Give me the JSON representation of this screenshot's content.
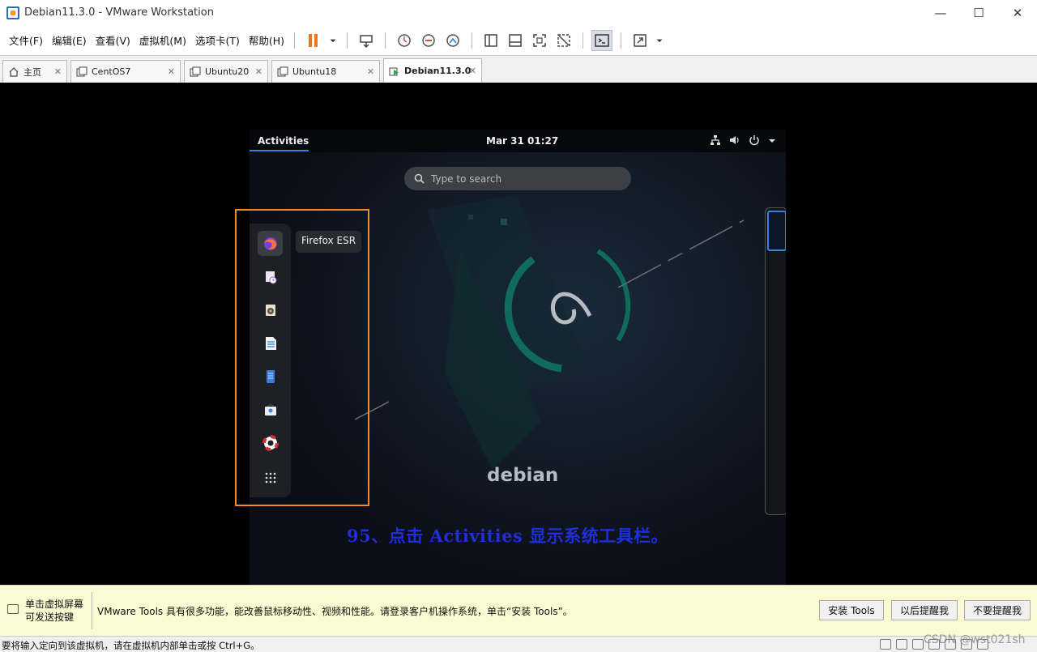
{
  "window": {
    "title": "Debian11.3.0 - VMware Workstation",
    "minimize": "—",
    "maximize": "☐",
    "close": "✕"
  },
  "menu": [
    "文件(F)",
    "编辑(E)",
    "查看(V)",
    "虚拟机(M)",
    "选项卡(T)",
    "帮助(H)"
  ],
  "tabs": [
    {
      "label": "主页",
      "close": "✕"
    },
    {
      "label": "CentOS7",
      "close": "✕"
    },
    {
      "label": "Ubuntu20",
      "close": "✕"
    },
    {
      "label": "Ubuntu18",
      "close": "✕"
    },
    {
      "label": "Debian11.3.0",
      "close": "✕"
    }
  ],
  "guest": {
    "activities": "Activities",
    "clock": "Mar 31  01:27",
    "search_placeholder": "Type to search",
    "tooltip": "Firefox ESR",
    "logo_text": "debian"
  },
  "caption": "95、点击 Activities  显示系统工具栏。",
  "infobar": {
    "left_line1": "单击虚拟屏幕",
    "left_line2": "可发送按键",
    "message": "VMware Tools 具有很多功能，能改善鼠标移动性、视频和性能。请登录客户机操作系统，单击“安装 Tools”。",
    "btn_install": "安装 Tools",
    "btn_later": "以后提醒我",
    "btn_never": "不要提醒我"
  },
  "status": {
    "text": "要将输入定向到该虚拟机，请在虚拟机内部单击或按 Ctrl+G。"
  },
  "watermark": "CSDN @wst021sh",
  "colors": {
    "accent": "#3584e4",
    "highlight": "#f08a30",
    "caption": "#1f2ed8",
    "infobar_bg": "#fcfad2"
  }
}
